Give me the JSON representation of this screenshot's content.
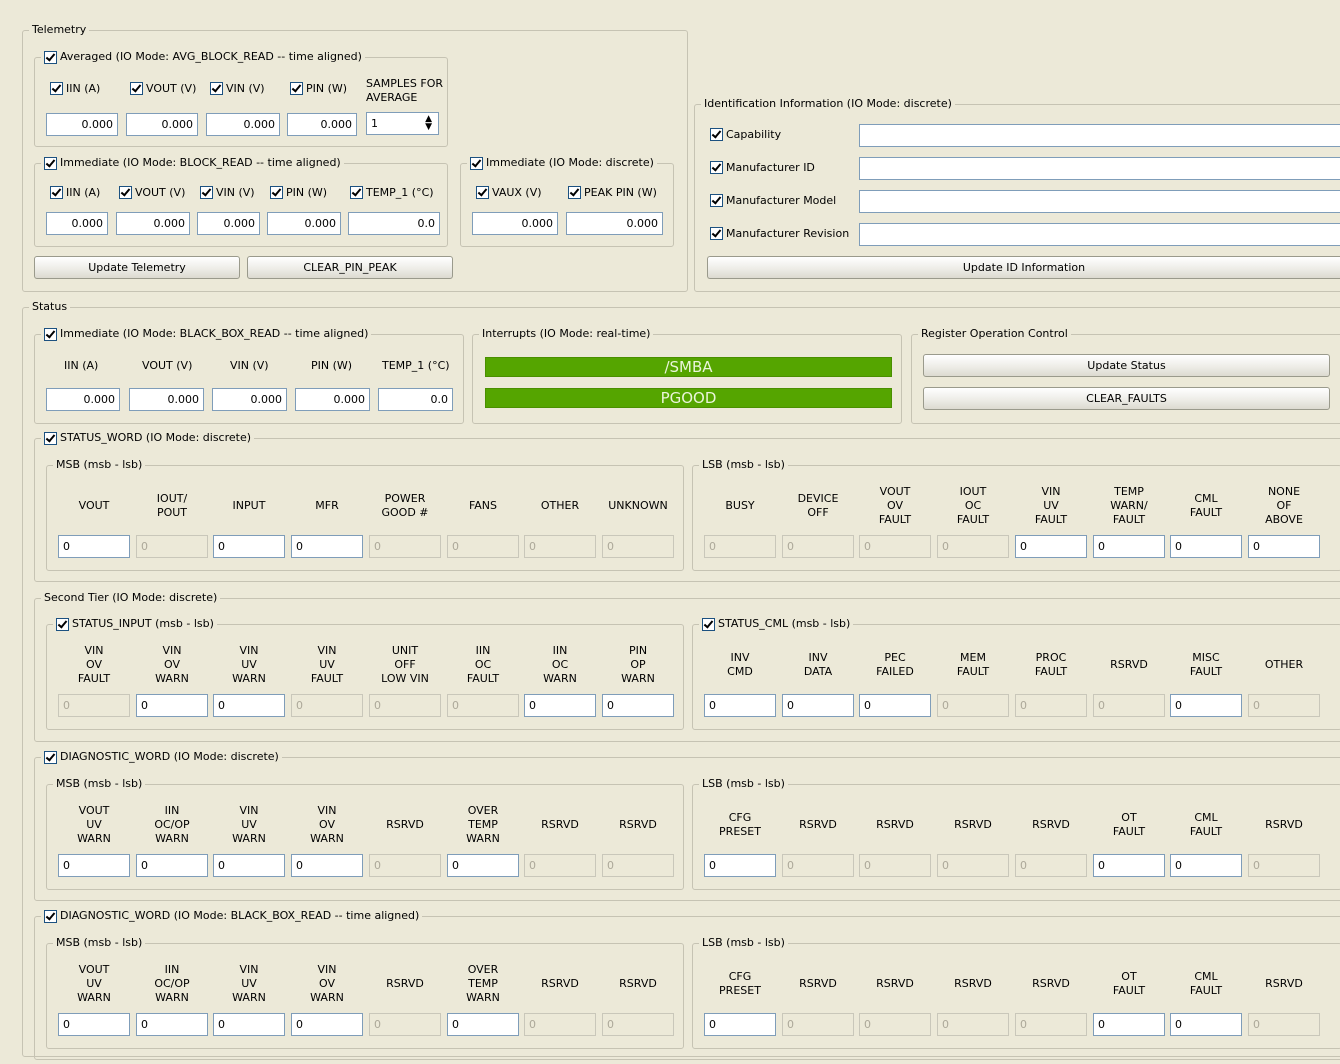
{
  "telemetry": {
    "title": "Telemetry",
    "averaged": {
      "title": "Averaged (IO Mode: AVG_BLOCK_READ -- time aligned)",
      "labels": [
        "IIN (A)",
        "VOUT (V)",
        "VIN (V)",
        "PIN (W)"
      ],
      "values": [
        "0.000",
        "0.000",
        "0.000",
        "0.000"
      ],
      "samples_label": "SAMPLES FOR AVERAGE",
      "samples_value": "1"
    },
    "immediate_block": {
      "title": "Immediate (IO Mode: BLOCK_READ -- time aligned)",
      "labels": [
        "IIN (A)",
        "VOUT (V)",
        "VIN (V)",
        "PIN (W)",
        "TEMP_1 (°C)"
      ],
      "values": [
        "0.000",
        "0.000",
        "0.000",
        "0.000",
        "0.0"
      ]
    },
    "immediate_discrete": {
      "title": "Immediate (IO Mode: discrete)",
      "labels": [
        "VAUX (V)",
        "PEAK PIN (W)"
      ],
      "values": [
        "0.000",
        "0.000"
      ]
    },
    "update_button": "Update Telemetry",
    "clear_pin_peak_button": "CLEAR_PIN_PEAK"
  },
  "identification": {
    "title": "Identification Information (IO Mode: discrete)",
    "rows": [
      {
        "label": "Capability",
        "value": ""
      },
      {
        "label": "Manufacturer ID",
        "value": ""
      },
      {
        "label": "Manufacturer Model",
        "value": ""
      },
      {
        "label": "Manufacturer Revision",
        "value": ""
      }
    ],
    "update_button": "Update ID Information"
  },
  "status": {
    "title": "Status",
    "immediate": {
      "title": "Immediate (IO Mode: BLACK_BOX_READ -- time aligned)",
      "labels": [
        "IIN (A)",
        "VOUT (V)",
        "VIN (V)",
        "PIN (W)",
        "TEMP_1 (°C)"
      ],
      "values": [
        "0.000",
        "0.000",
        "0.000",
        "0.000",
        "0.0"
      ]
    },
    "interrupts": {
      "title": "Interrupts (IO Mode: real-time)",
      "smba": "/SMBA",
      "pgood": "PGOOD",
      "led_color": "#55a500"
    },
    "register_control": {
      "title": "Register Operation Control",
      "update_button": "Update Status",
      "clear_faults_button": "CLEAR_FAULTS"
    },
    "status_word": {
      "title": "STATUS_WORD (IO Mode: discrete)",
      "msb": {
        "title": "MSB (msb - lsb)",
        "headers": [
          "VOUT",
          "IOUT/\nPOUT",
          "INPUT",
          "MFR",
          "POWER\nGOOD #",
          "FANS",
          "OTHER",
          "UNKNOWN"
        ],
        "values": [
          "0",
          "0",
          "0",
          "0",
          "0",
          "0",
          "0",
          "0"
        ],
        "enabled": [
          true,
          false,
          true,
          true,
          false,
          false,
          false,
          false
        ]
      },
      "lsb": {
        "title": "LSB (msb - lsb)",
        "headers": [
          "BUSY",
          "DEVICE\nOFF",
          "VOUT\nOV\nFAULT",
          "IOUT\nOC\nFAULT",
          "VIN\nUV\nFAULT",
          "TEMP\nWARN/\nFAULT",
          "CML\nFAULT",
          "NONE\nOF\nABOVE"
        ],
        "values": [
          "0",
          "0",
          "0",
          "0",
          "0",
          "0",
          "0",
          "0"
        ],
        "enabled": [
          false,
          false,
          false,
          false,
          true,
          true,
          true,
          true
        ]
      }
    },
    "second_tier": {
      "title": "Second Tier (IO Mode: discrete)",
      "input": {
        "title": "STATUS_INPUT (msb - lsb)",
        "headers": [
          "VIN\nOV\nFAULT",
          "VIN\nOV\nWARN",
          "VIN\nUV\nWARN",
          "VIN\nUV\nFAULT",
          "UNIT\nOFF\nLOW VIN",
          "IIN\nOC\nFAULT",
          "IIN\nOC\nWARN",
          "PIN\nOP\nWARN"
        ],
        "values": [
          "0",
          "0",
          "0",
          "0",
          "0",
          "0",
          "0",
          "0"
        ],
        "enabled": [
          false,
          true,
          true,
          false,
          false,
          false,
          true,
          true
        ]
      },
      "cml": {
        "title": "STATUS_CML (msb - lsb)",
        "headers": [
          "INV\nCMD",
          "INV\nDATA",
          "PEC\nFAILED",
          "MEM\nFAULT",
          "PROC\nFAULT",
          "RSRVD",
          "MISC\nFAULT",
          "OTHER"
        ],
        "values": [
          "0",
          "0",
          "0",
          "0",
          "0",
          "0",
          "0",
          "0"
        ],
        "enabled": [
          true,
          true,
          true,
          false,
          false,
          false,
          true,
          false
        ]
      }
    },
    "diag_discrete": {
      "title": "DIAGNOSTIC_WORD (IO Mode: discrete)",
      "msb": {
        "title": "MSB (msb - lsb)",
        "headers": [
          "VOUT\nUV\nWARN",
          "IIN\nOC/OP\nWARN",
          "VIN\nUV\nWARN",
          "VIN\nOV\nWARN",
          "RSRVD",
          "OVER\nTEMP\nWARN",
          "RSRVD",
          "RSRVD"
        ],
        "values": [
          "0",
          "0",
          "0",
          "0",
          "0",
          "0",
          "0",
          "0"
        ],
        "enabled": [
          true,
          true,
          true,
          true,
          false,
          true,
          false,
          false
        ]
      },
      "lsb": {
        "title": "LSB (msb - lsb)",
        "headers": [
          "CFG\nPRESET",
          "RSRVD",
          "RSRVD",
          "RSRVD",
          "RSRVD",
          "OT\nFAULT",
          "CML\nFAULT",
          "RSRVD"
        ],
        "values": [
          "0",
          "0",
          "0",
          "0",
          "0",
          "0",
          "0",
          "0"
        ],
        "enabled": [
          true,
          false,
          false,
          false,
          false,
          true,
          true,
          false
        ]
      }
    },
    "diag_blackbox": {
      "title": "DIAGNOSTIC_WORD (IO Mode: BLACK_BOX_READ -- time aligned)",
      "msb": {
        "title": "MSB (msb - lsb)",
        "headers": [
          "VOUT\nUV\nWARN",
          "IIN\nOC/OP\nWARN",
          "VIN\nUV\nWARN",
          "VIN\nOV\nWARN",
          "RSRVD",
          "OVER\nTEMP\nWARN",
          "RSRVD",
          "RSRVD"
        ],
        "values": [
          "0",
          "0",
          "0",
          "0",
          "0",
          "0",
          "0",
          "0"
        ],
        "enabled": [
          true,
          true,
          true,
          true,
          false,
          true,
          false,
          false
        ]
      },
      "lsb": {
        "title": "LSB (msb - lsb)",
        "headers": [
          "CFG\nPRESET",
          "RSRVD",
          "RSRVD",
          "RSRVD",
          "RSRVD",
          "OT\nFAULT",
          "CML\nFAULT",
          "RSRVD"
        ],
        "values": [
          "0",
          "0",
          "0",
          "0",
          "0",
          "0",
          "0",
          "0"
        ],
        "enabled": [
          true,
          false,
          false,
          false,
          false,
          true,
          true,
          false
        ]
      }
    }
  }
}
